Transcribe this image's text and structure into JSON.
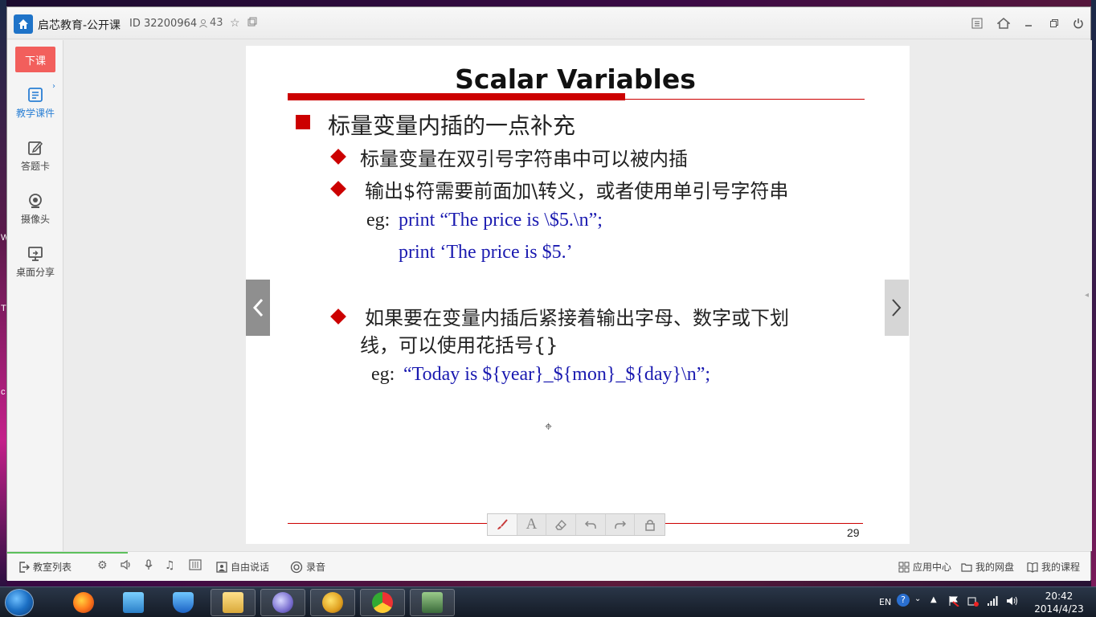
{
  "window": {
    "app_title": "启芯教育-公开课",
    "room_id": "ID 32200964",
    "user_count": "43"
  },
  "sidebar": {
    "end_class": "下课",
    "items": [
      {
        "label": "教学课件",
        "icon": "courseware-icon",
        "active": true
      },
      {
        "label": "答题卡",
        "icon": "answer-card-icon",
        "active": false
      },
      {
        "label": "摄像头",
        "icon": "camera-icon",
        "active": false
      },
      {
        "label": "桌面分享",
        "icon": "screen-share-icon",
        "active": false
      }
    ]
  },
  "slide": {
    "title": "Scalar Variables",
    "heading": "标量变量内插的一点补充",
    "point1": "标量变量在双引号字符串中可以被内插",
    "point2": "输出$符需要前面加\\转义，或者使用单引号字符串",
    "eg1_label": "eg:",
    "eg1_code": "print “The price is \\$5.\\n”;",
    "eg2_code": "print ‘The price is $5.’",
    "point3_line1": "如果要在变量内插后紧接着输出字母、数字或下划",
    "point3_line2": "线，可以使用花括号{}",
    "eg3_label": "eg:",
    "eg3_code": "“Today is ${year}_${mon}_${day}\\n”;",
    "page_number": "29"
  },
  "drawbar": {
    "tools": [
      "brush-icon",
      "text-icon",
      "eraser-icon",
      "undo-icon",
      "redo-icon",
      "lock-icon"
    ],
    "text_tool_glyph": "A"
  },
  "bottombar": {
    "room_list": "教室列表",
    "free_talk": "自由说话",
    "record": "录音",
    "app_center": "应用中心",
    "my_disk": "我的网盘",
    "my_course": "我的课程"
  },
  "taskbar": {
    "lang": "EN",
    "time": "20:42",
    "date": "2014/4/23"
  },
  "colors": {
    "accent_red": "#cc0000",
    "end_class_bg": "#f25f5c",
    "code_blue": "#1a1ab0",
    "sidebar_active": "#2a7fd4"
  }
}
